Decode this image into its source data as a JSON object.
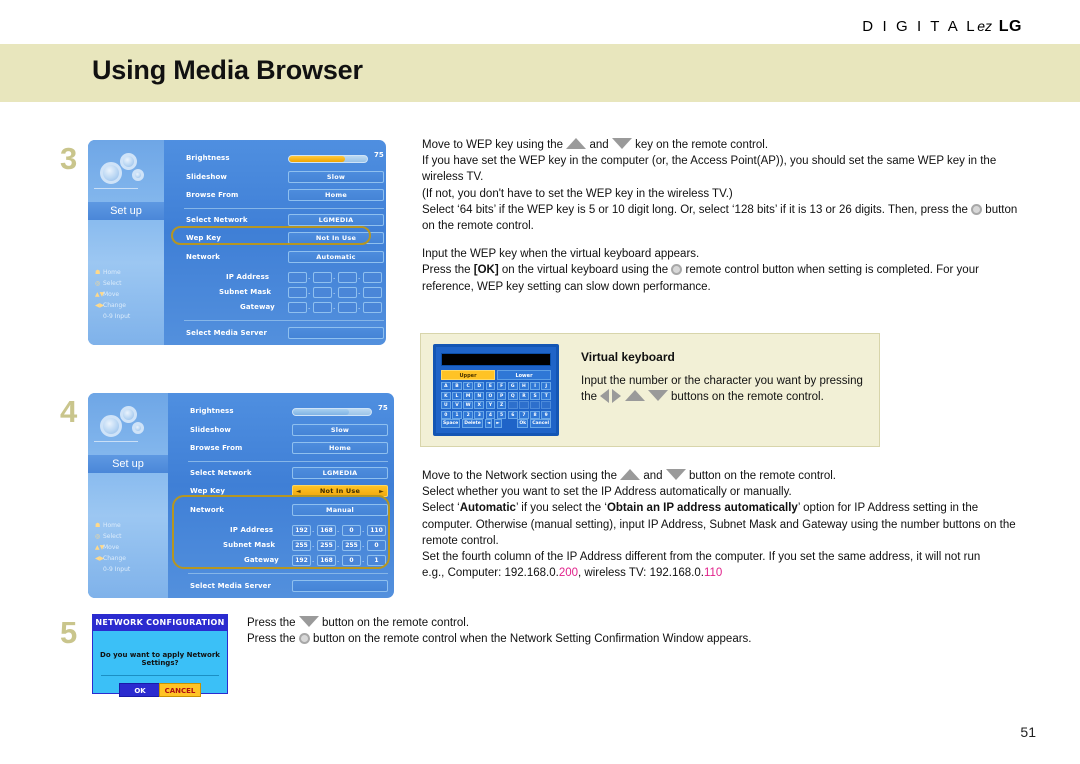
{
  "brand": {
    "digital": "D I G I T A L",
    "ez": "ez",
    "lg": "LG"
  },
  "header": {
    "title": "Using Media Browser"
  },
  "page": {
    "number": "51"
  },
  "colors": {
    "header_band": "#e8e6bd",
    "step_number": "#c9c58c",
    "osd_blue": "#4584d6",
    "highlight_ring": "#b59622",
    "selected_amber": "#ffc325",
    "accent_text": "#e0218a"
  },
  "steps": [
    {
      "number": "3"
    },
    {
      "number": "4"
    },
    {
      "number": "5"
    }
  ],
  "osd_step3": {
    "sidebar": {
      "setup_label": "Set up",
      "legend": [
        {
          "icon": "home-icon",
          "label": "Home"
        },
        {
          "icon": "select-icon",
          "label": "Select"
        },
        {
          "icon": "updown-icon",
          "label": "Move"
        },
        {
          "icon": "leftright-icon",
          "label": "Change"
        },
        {
          "icon": "numeric-icon",
          "label": "0-9 Input"
        }
      ]
    },
    "rows": {
      "brightness_label": "Brightness",
      "brightness_value": "75",
      "brightness_pct": 72,
      "slideshow_label": "Slideshow",
      "slideshow_value": "Slow",
      "browse_from_label": "Browse From",
      "browse_from_value": "Home",
      "select_network_label": "Select Network",
      "select_network_value": "LGMEDIA",
      "wep_key_label": "Wep Key",
      "wep_key_value": "Not In Use",
      "network_label": "Network",
      "network_value": "Automatic",
      "ip_address_label": "IP Address",
      "subnet_mask_label": "Subnet Mask",
      "gateway_label": "Gateway",
      "ip_address": [
        "",
        "",
        "",
        ""
      ],
      "subnet_mask": [
        "",
        "",
        "",
        ""
      ],
      "gateway": [
        "",
        "",
        "",
        ""
      ],
      "select_media_server_label": "Select Media Server",
      "select_media_server_value": ""
    }
  },
  "osd_step4": {
    "sidebar": {
      "setup_label": "Set up",
      "legend": [
        {
          "icon": "home-icon",
          "label": "Home"
        },
        {
          "icon": "select-icon",
          "label": "Select"
        },
        {
          "icon": "updown-icon",
          "label": "Move"
        },
        {
          "icon": "leftright-icon",
          "label": "Change"
        },
        {
          "icon": "numeric-icon",
          "label": "0-9 Input"
        }
      ]
    },
    "rows": {
      "brightness_label": "Brightness",
      "brightness_value": "75",
      "brightness_pct": 72,
      "slideshow_label": "Slideshow",
      "slideshow_value": "Slow",
      "browse_from_label": "Browse From",
      "browse_from_value": "Home",
      "select_network_label": "Select Network",
      "select_network_value": "LGMEDIA",
      "wep_key_label": "Wep Key",
      "wep_key_value": "Not In Use",
      "wep_key_arrow_left": "◄",
      "wep_key_arrow_right": "►",
      "network_label": "Network",
      "network_value": "Manual",
      "ip_address_label": "IP Address",
      "subnet_mask_label": "Subnet Mask",
      "gateway_label": "Gateway",
      "ip_address": [
        "192",
        "168",
        "0",
        "110"
      ],
      "subnet_mask": [
        "255",
        "255",
        "255",
        "0"
      ],
      "gateway": [
        "192",
        "168",
        "0",
        "1"
      ],
      "select_media_server_label": "Select Media Server",
      "select_media_server_value": ""
    }
  },
  "dialog_step5": {
    "title": "NETWORK CONFIGURATION",
    "message": "Do you want to apply Network Settings?",
    "ok_label": "OK",
    "cancel_label": "CANCEL"
  },
  "virtual_keyboard": {
    "title": "Virtual keyboard",
    "text_before": "Input the number or the character you want by pressing the",
    "text_after": "buttons on the remote control.",
    "tabs": [
      "Upper",
      "Lower"
    ],
    "active_tab": "Upper",
    "rows": [
      [
        "A",
        "B",
        "C",
        "D",
        "E",
        "F",
        "G",
        "H",
        "I",
        "J"
      ],
      [
        "K",
        "L",
        "M",
        "N",
        "O",
        "P",
        "Q",
        "R",
        "S",
        "T"
      ],
      [
        "U",
        "V",
        "W",
        "X",
        "Y",
        "Z",
        "",
        "",
        "",
        ""
      ],
      [
        "0",
        "1",
        "2",
        "3",
        "4",
        "5",
        "6",
        "7",
        "8",
        "9"
      ]
    ],
    "bottom_keys": [
      "Space",
      "Delete",
      "◄",
      "►",
      "Ok",
      "Cancel"
    ]
  },
  "text_block_step3": {
    "line1_a": "Move to WEP key using the",
    "line1_b": "and",
    "line1_c": "key on the remote control.",
    "line2": "If you have set the WEP key in the computer (or, the Access Point(AP)), you should set the same WEP key in the wireless TV.",
    "line3": "(If not, you don't have to set the WEP key in the wireless TV.)",
    "line4_a": "Select ‘64 bits’ if the WEP key is 5 or 10 digit long. Or, select ‘128 bits’ if it is 13 or 26 digits. Then, press the",
    "line4_b": "button on the remote control.",
    "line5": "Input the WEP key when the virtual keyboard appears.",
    "line6_a": "Press the",
    "line6_ok": "[OK]",
    "line6_b": "on the virtual keyboard using the",
    "line6_c": "remote control button when setting is completed. For your reference, WEP key setting can slow down performance."
  },
  "text_block_step4": {
    "line1_a": "Move to the Network section using the",
    "line1_b": "and",
    "line1_c": "button on the remote control.",
    "line2": "Select whether you want to set the IP Address automatically or manually.",
    "line3_a": "Select ‘",
    "line3_bold1": "Automatic",
    "line3_b": "’ if you select the ‘",
    "line3_bold2": "Obtain an IP address automatically",
    "line3_c": "’ option for IP Address setting in the computer. Otherwise (manual setting), input IP Address, Subnet Mask and Gateway using the number buttons on the remote control.",
    "line4": "Set the fourth column of the IP Address different from the computer. If you set the same address, it will not run",
    "line5_a": "e.g., Computer: 192.168.0.",
    "line5_accent1": "200",
    "line5_b": ", wireless TV: 192.168.0.",
    "line5_accent2": "110"
  },
  "text_block_step5": {
    "line1_a": "Press the",
    "line1_b": "button on the remote control.",
    "line2_a": "Press the",
    "line2_b": "button on the remote control when the Network Setting Confirmation Window appears."
  }
}
